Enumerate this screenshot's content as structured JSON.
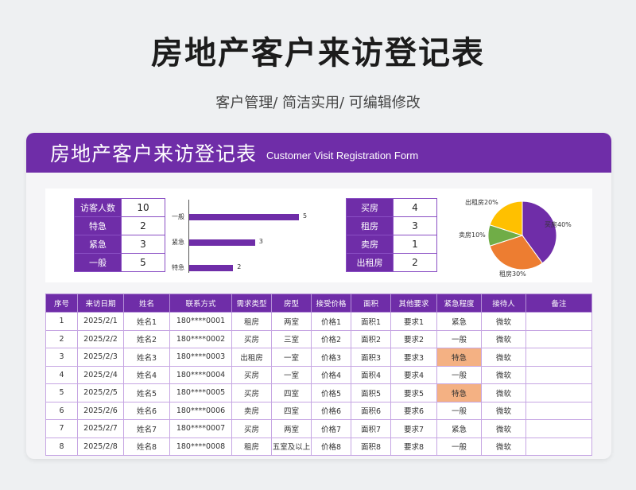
{
  "page": {
    "title": "房地产客户来访登记表",
    "subtitle": "客户管理/ 简洁实用/ 可编辑修改"
  },
  "card": {
    "title_cn": "房地产客户来访登记表",
    "title_en": "Customer Visit Registration Form"
  },
  "summary_left": [
    {
      "label": "访客人数",
      "value": "10"
    },
    {
      "label": "特急",
      "value": "2"
    },
    {
      "label": "紧急",
      "value": "3"
    },
    {
      "label": "一般",
      "value": "5"
    }
  ],
  "summary_right": [
    {
      "label": "买房",
      "value": "4"
    },
    {
      "label": "租房",
      "value": "3"
    },
    {
      "label": "卖房",
      "value": "1"
    },
    {
      "label": "出租房",
      "value": "2"
    }
  ],
  "colors": {
    "accent": "#6f2da8",
    "highlight": "#f4b183",
    "pie": [
      "#6f2da8",
      "#ed7d31",
      "#70ad47",
      "#ffc000"
    ]
  },
  "chart_data": [
    {
      "type": "bar",
      "orientation": "horizontal",
      "categories": [
        "一般",
        "紧急",
        "特急"
      ],
      "values": [
        5,
        3,
        2
      ],
      "xlim": [
        0,
        5
      ]
    },
    {
      "type": "pie",
      "labels": [
        "买房40%",
        "租房30%",
        "卖房10%",
        "出租房20%"
      ],
      "values": [
        40,
        30,
        10,
        20
      ]
    }
  ],
  "table": {
    "headers": [
      "序号",
      "来访日期",
      "姓名",
      "联系方式",
      "需求类型",
      "房型",
      "接受价格",
      "面积",
      "其他要求",
      "紧急程度",
      "接待人",
      "备注"
    ],
    "rows": [
      [
        "1",
        "2025/2/1",
        "姓名1",
        "180****0001",
        "租房",
        "两室",
        "价格1",
        "面积1",
        "要求1",
        "紧急",
        "微软",
        ""
      ],
      [
        "2",
        "2025/2/2",
        "姓名2",
        "180****0002",
        "买房",
        "三室",
        "价格2",
        "面积2",
        "要求2",
        "一般",
        "微软",
        ""
      ],
      [
        "3",
        "2025/2/3",
        "姓名3",
        "180****0003",
        "出租房",
        "一室",
        "价格3",
        "面积3",
        "要求3",
        "特急",
        "微软",
        ""
      ],
      [
        "4",
        "2025/2/4",
        "姓名4",
        "180****0004",
        "买房",
        "一室",
        "价格4",
        "面积4",
        "要求4",
        "一般",
        "微软",
        ""
      ],
      [
        "5",
        "2025/2/5",
        "姓名5",
        "180****0005",
        "买房",
        "四室",
        "价格5",
        "面积5",
        "要求5",
        "特急",
        "微软",
        ""
      ],
      [
        "6",
        "2025/2/6",
        "姓名6",
        "180****0006",
        "卖房",
        "四室",
        "价格6",
        "面积6",
        "要求6",
        "一般",
        "微软",
        ""
      ],
      [
        "7",
        "2025/2/7",
        "姓名7",
        "180****0007",
        "买房",
        "两室",
        "价格7",
        "面积7",
        "要求7",
        "紧急",
        "微软",
        ""
      ],
      [
        "8",
        "2025/2/8",
        "姓名8",
        "180****0008",
        "租房",
        "五室及以上",
        "价格8",
        "面积8",
        "要求8",
        "一般",
        "微软",
        ""
      ]
    ]
  }
}
